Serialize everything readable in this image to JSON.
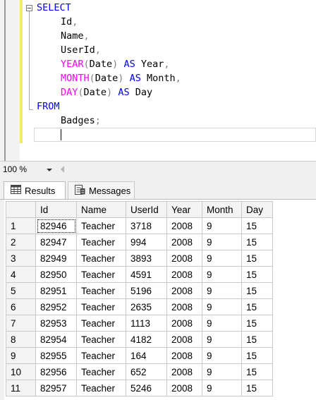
{
  "editor": {
    "lines": [
      {
        "parts": [
          {
            "t": "SELECT",
            "c": "kw"
          }
        ]
      },
      {
        "indent": true,
        "parts": [
          {
            "t": "Id"
          },
          {
            "t": ",",
            "c": "gy"
          }
        ]
      },
      {
        "indent": true,
        "parts": [
          {
            "t": "Name"
          },
          {
            "t": ",",
            "c": "gy"
          }
        ]
      },
      {
        "indent": true,
        "parts": [
          {
            "t": "UserId"
          },
          {
            "t": ",",
            "c": "gy"
          }
        ]
      },
      {
        "indent": true,
        "parts": [
          {
            "t": "YEAR",
            "c": "fn"
          },
          {
            "t": "(",
            "c": "gy"
          },
          {
            "t": "Date"
          },
          {
            "t": ")",
            "c": "gy"
          },
          {
            "t": " AS ",
            "c": "kw"
          },
          {
            "t": "Year"
          },
          {
            "t": ",",
            "c": "gy"
          }
        ]
      },
      {
        "indent": true,
        "parts": [
          {
            "t": "MONTH",
            "c": "fn"
          },
          {
            "t": "(",
            "c": "gy"
          },
          {
            "t": "Date"
          },
          {
            "t": ")",
            "c": "gy"
          },
          {
            "t": " AS ",
            "c": "kw"
          },
          {
            "t": "Month"
          },
          {
            "t": ",",
            "c": "gy"
          }
        ]
      },
      {
        "indent": true,
        "parts": [
          {
            "t": "DAY",
            "c": "fn"
          },
          {
            "t": "(",
            "c": "gy"
          },
          {
            "t": "Date"
          },
          {
            "t": ")",
            "c": "gy"
          },
          {
            "t": " AS ",
            "c": "kw"
          },
          {
            "t": "Day"
          }
        ]
      },
      {
        "parts": [
          {
            "t": "FROM",
            "c": "kw"
          }
        ]
      },
      {
        "indent": true,
        "parts": [
          {
            "t": "Badges"
          },
          {
            "t": ";",
            "c": "gy"
          }
        ]
      },
      {
        "indent": true,
        "parts": []
      }
    ],
    "colors": {
      "keyword": "#0000ff",
      "function": "#ff00ff",
      "punctuation": "#808080"
    }
  },
  "zoom": {
    "value": "100 %"
  },
  "tabs": [
    {
      "label": "Results",
      "icon": "grid-icon",
      "active": true
    },
    {
      "label": "Messages",
      "icon": "messages-icon",
      "active": false
    }
  ],
  "results": {
    "columns": [
      "Id",
      "Name",
      "UserId",
      "Year",
      "Month",
      "Day"
    ],
    "rows": [
      [
        "1",
        "82946",
        "Teacher",
        "3718",
        "2008",
        "9",
        "15"
      ],
      [
        "2",
        "82947",
        "Teacher",
        "994",
        "2008",
        "9",
        "15"
      ],
      [
        "3",
        "82949",
        "Teacher",
        "3893",
        "2008",
        "9",
        "15"
      ],
      [
        "4",
        "82950",
        "Teacher",
        "4591",
        "2008",
        "9",
        "15"
      ],
      [
        "5",
        "82951",
        "Teacher",
        "5196",
        "2008",
        "9",
        "15"
      ],
      [
        "6",
        "82952",
        "Teacher",
        "2635",
        "2008",
        "9",
        "15"
      ],
      [
        "7",
        "82953",
        "Teacher",
        "1113",
        "2008",
        "9",
        "15"
      ],
      [
        "8",
        "82954",
        "Teacher",
        "4182",
        "2008",
        "9",
        "15"
      ],
      [
        "9",
        "82955",
        "Teacher",
        "164",
        "2008",
        "9",
        "15"
      ],
      [
        "10",
        "82956",
        "Teacher",
        "652",
        "2008",
        "9",
        "15"
      ],
      [
        "11",
        "82957",
        "Teacher",
        "5246",
        "2008",
        "9",
        "15"
      ]
    ]
  }
}
